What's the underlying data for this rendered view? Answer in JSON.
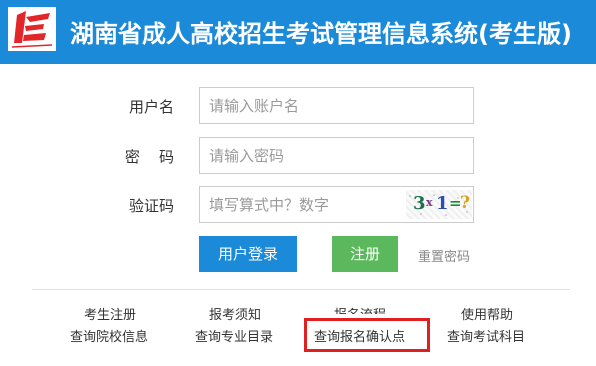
{
  "header": {
    "title": "湖南省成人高校招生考试管理信息系统(考生版)",
    "background_color": "#1b8ad8",
    "logo_icon": "hunan-exam-logo"
  },
  "form": {
    "username": {
      "label": "用户名",
      "placeholder": "请输入账户名",
      "value": ""
    },
    "password": {
      "label": "密    码",
      "placeholder": "请输入密码",
      "value": ""
    },
    "captcha": {
      "label": "验证码",
      "placeholder": "填写算式中？数字",
      "value": "",
      "image": {
        "first": "3",
        "operator": "x",
        "second": "1",
        "equals": "=",
        "unknown": "?"
      }
    }
  },
  "buttons": {
    "login": "用户登录",
    "register": "注册",
    "reset_password": "重置密码",
    "login_color": "#1b8ad8",
    "register_color": "#5cb85c"
  },
  "links": {
    "row1": [
      "考生注册",
      "报考须知",
      "报名流程",
      "使用帮助"
    ],
    "row2": [
      "查询院校信息",
      "查询专业目录",
      "查询报名确认点",
      "查询考试科目"
    ]
  },
  "highlight": {
    "color": "#e02020",
    "target": "查询报名确认点"
  }
}
